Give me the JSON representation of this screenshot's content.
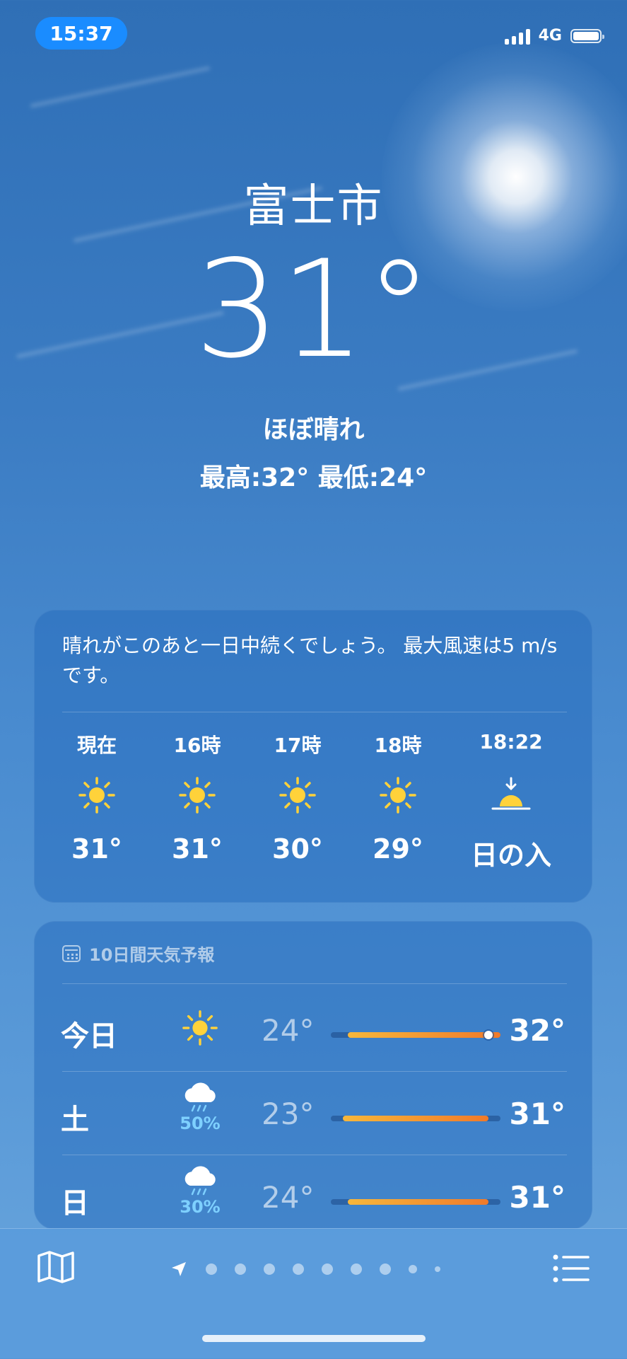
{
  "status_bar": {
    "time": "15:37",
    "network": "4G"
  },
  "location": {
    "city": "富士市",
    "temperature": "31°",
    "condition": "ほぼ晴れ",
    "high_low": "最高:32° 最低:24°"
  },
  "hourly": {
    "summary": "晴れがこのあと一日中続くでしょう。 最大風速は5 m/s です。",
    "items": [
      {
        "time": "現在",
        "icon": "sun-icon",
        "temp": "31°"
      },
      {
        "time": "16時",
        "icon": "sun-icon",
        "temp": "31°"
      },
      {
        "time": "17時",
        "icon": "sun-icon",
        "temp": "30°"
      },
      {
        "time": "18時",
        "icon": "sun-icon",
        "temp": "29°"
      },
      {
        "time": "18:22",
        "icon": "sunset-icon",
        "temp": "日の入"
      }
    ]
  },
  "daily": {
    "title": "10日間天気予報",
    "days": [
      {
        "day": "今日",
        "icon": "sun-icon",
        "precip": "",
        "low": "24°",
        "high": "32°",
        "bar_start": 0.1,
        "bar_end": 1.0,
        "current_marker": 0.93
      },
      {
        "day": "土",
        "icon": "cloud-rain-icon",
        "precip": "50%",
        "low": "23°",
        "high": "31°",
        "bar_start": 0.07,
        "bar_end": 0.93
      },
      {
        "day": "日",
        "icon": "cloud-rain-icon",
        "precip": "30%",
        "low": "24°",
        "high": "31°",
        "bar_start": 0.1,
        "bar_end": 0.93
      }
    ]
  },
  "bottom_bar": {
    "pages": 9,
    "active_page": 0
  },
  "colors": {
    "accent": "#1a8cff",
    "bar_start": "#f6b73c",
    "bar_end": "#f07a2a",
    "precip": "#7ed0ff",
    "sun": "#ffd23a"
  }
}
